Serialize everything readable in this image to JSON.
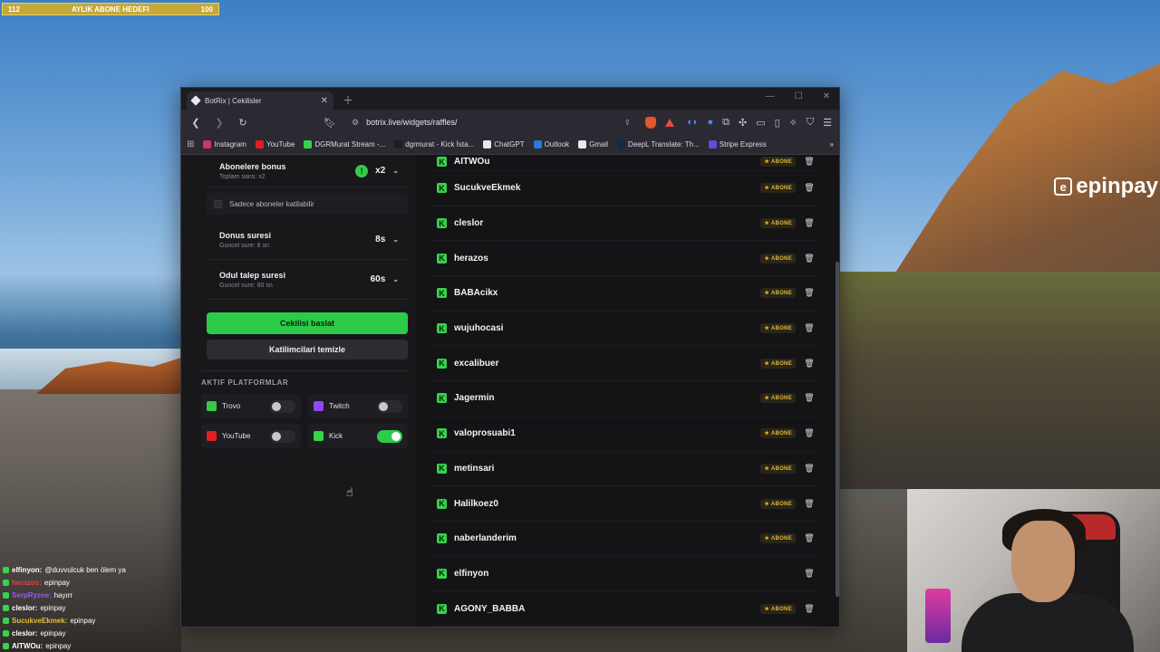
{
  "overlay": {
    "goal": {
      "current": "112",
      "title": "AYLIK ABONE HEDEFI",
      "target": "100"
    },
    "logo_text": "epinpay",
    "chat": [
      {
        "user": "elfinyon:",
        "msg": "@duvvulcuk ben ölem ya",
        "color": "#ffffff"
      },
      {
        "user": "herazos:",
        "msg": "epinpay",
        "color": "#e04040"
      },
      {
        "user": "SerpRyzee:",
        "msg": "hayırr",
        "color": "#9b59f0"
      },
      {
        "user": "cleslor:",
        "msg": "epinpay",
        "color": "#ffffff"
      },
      {
        "user": "SucukveEkmek:",
        "msg": "epinpay",
        "color": "#e0c040"
      },
      {
        "user": "cleslor:",
        "msg": "epinpay",
        "color": "#ffffff"
      },
      {
        "user": "AITWOu:",
        "msg": "epinpay",
        "color": "#ffffff"
      }
    ]
  },
  "browser": {
    "tab_title": "BotRix | Cekilisler",
    "url": "botrix.live/widgets/raffles/",
    "bookmarks": [
      {
        "label": "Instagram",
        "color": "#d6306a"
      },
      {
        "label": "YouTube",
        "color": "#e02020"
      },
      {
        "label": "DGRMurat Stream -...",
        "color": "#36d34c"
      },
      {
        "label": "dgrmurat - Kick İsta...",
        "color": "#1e1e1e"
      },
      {
        "label": "ChatGPT",
        "color": "#e8e8e8"
      },
      {
        "label": "Outlook",
        "color": "#2a7ad8"
      },
      {
        "label": "Gmail",
        "color": "#e8e8e8"
      },
      {
        "label": "DeepL Translate: Th...",
        "color": "#0c2a4a"
      },
      {
        "label": "Stripe Express",
        "color": "#6a48d8"
      }
    ]
  },
  "settings": {
    "sub_bonus": {
      "title": "Abonelere bonus",
      "sub": "Toplam sans: x2",
      "value": "x2"
    },
    "subs_only": {
      "label": "Sadece aboneler katilabilir"
    },
    "spin_time": {
      "title": "Donus suresi",
      "sub": "Guncel sure: 8 sn",
      "value": "8s"
    },
    "claim_time": {
      "title": "Odul talep suresi",
      "sub": "Guncel sure: 60 sn",
      "value": "60s"
    },
    "start_button": "Cekilisi baslat",
    "clear_button": "Katilimcilari temizle",
    "platforms_title": "AKTIF PLATFORMLAR",
    "platforms": [
      {
        "label": "Trovo",
        "on": false,
        "color": "#36c94a"
      },
      {
        "label": "Twitch",
        "on": false,
        "color": "#9146ff"
      },
      {
        "label": "YouTube",
        "on": false,
        "color": "#e02020"
      },
      {
        "label": "Kick",
        "on": true,
        "color": "#36d34c"
      }
    ]
  },
  "participants": [
    {
      "name": "AITWOu",
      "subscriber": true
    },
    {
      "name": "SucukveEkmek",
      "subscriber": true
    },
    {
      "name": "cleslor",
      "subscriber": true
    },
    {
      "name": "herazos",
      "subscriber": true
    },
    {
      "name": "BABAcikx",
      "subscriber": true
    },
    {
      "name": "wujuhocasi",
      "subscriber": true
    },
    {
      "name": "excalibuer",
      "subscriber": true
    },
    {
      "name": "Jagermin",
      "subscriber": true
    },
    {
      "name": "valoprosuabi1",
      "subscriber": true
    },
    {
      "name": "metinsari",
      "subscriber": true
    },
    {
      "name": "Halilkoez0",
      "subscriber": true
    },
    {
      "name": "naberlanderim",
      "subscriber": true
    },
    {
      "name": "elfinyon",
      "subscriber": false
    },
    {
      "name": "AGONY_BABBA",
      "subscriber": true
    }
  ],
  "badge_label": "ABONE"
}
